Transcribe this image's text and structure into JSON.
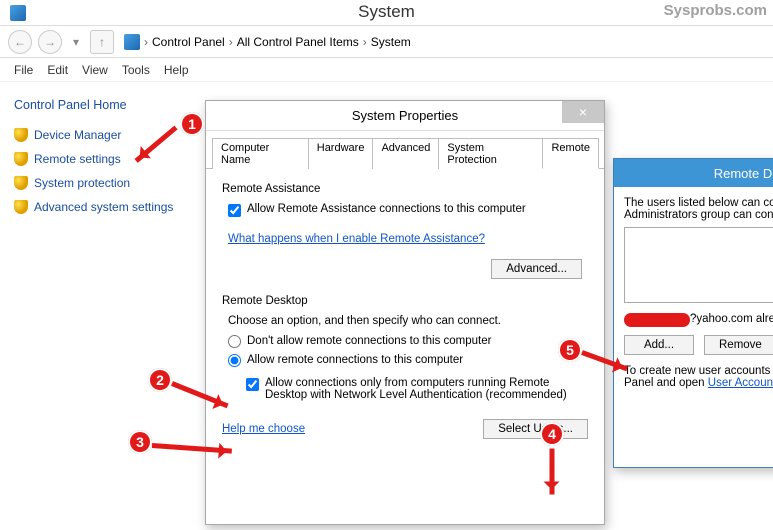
{
  "window": {
    "title": "System",
    "watermark": "Sysprobs.com"
  },
  "nav": {
    "back_glyph": "←",
    "fwd_glyph": "→",
    "up_glyph": "↑",
    "drop_glyph": "▾",
    "crumbs": [
      "Control Panel",
      "All Control Panel Items",
      "System"
    ],
    "sep": "›"
  },
  "menubar": [
    "File",
    "Edit",
    "View",
    "Tools",
    "Help"
  ],
  "sidebar": {
    "home": "Control Panel Home",
    "links": [
      "Device Manager",
      "Remote settings",
      "System protection",
      "Advanced system settings"
    ]
  },
  "annotations": {
    "n1": "1",
    "n2": "2",
    "n3": "3",
    "n4": "4",
    "n5": "5"
  },
  "sysprops": {
    "title": "System Properties",
    "close_glyph": "×",
    "tabs": [
      "Computer Name",
      "Hardware",
      "Advanced",
      "System Protection",
      "Remote"
    ],
    "ra_group": "Remote Assistance",
    "ra_check": "Allow Remote Assistance connections to this computer",
    "ra_what": "What happens when I enable Remote Assistance?",
    "advanced_btn": "Advanced...",
    "rd_group": "Remote Desktop",
    "rd_intro": "Choose an option, and then specify who can connect.",
    "rd_opt1": "Don't allow remote connections to this computer",
    "rd_opt2": "Allow remote connections to this computer",
    "rd_nla": "Allow connections only from computers running Remote Desktop with Network Level Authentication (recommended)",
    "help_me": "Help me choose",
    "select_users_btn": "Select Users..."
  },
  "rdusers": {
    "title": "Remote D",
    "intro": "The users listed below can connect the Administrators group can conne",
    "masked_tail": "?yahoo.com already h",
    "add_btn": "Add...",
    "remove_btn": "Remove",
    "create_text1": "To create new user accounts or ad",
    "create_text2": "Panel and open ",
    "user_accounts_link": "User Accounts"
  }
}
